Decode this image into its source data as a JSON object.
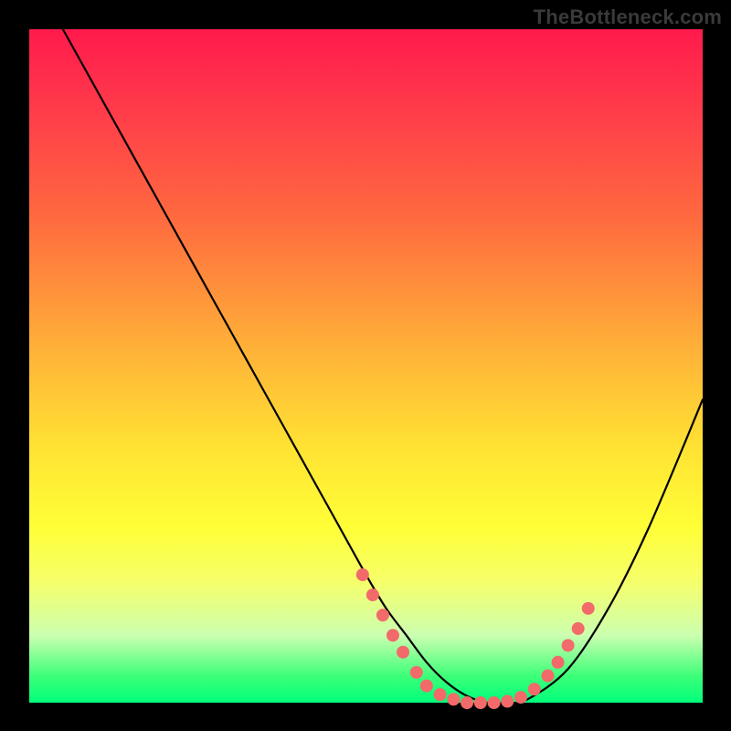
{
  "watermark": "TheBottleneck.com",
  "chart_data": {
    "type": "line",
    "title": "",
    "xlabel": "",
    "ylabel": "",
    "xlim": [
      0,
      100
    ],
    "ylim": [
      0,
      100
    ],
    "grid": false,
    "series": [
      {
        "name": "curve",
        "x": [
          5,
          10,
          15,
          20,
          25,
          30,
          35,
          40,
          45,
          50,
          53,
          56,
          59,
          62,
          65,
          68,
          71,
          74,
          80,
          86,
          92,
          100
        ],
        "values": [
          100,
          91,
          82,
          73,
          64,
          55,
          46,
          37,
          28,
          19,
          14,
          10,
          6,
          3,
          1,
          0,
          0,
          0.5,
          5,
          14,
          26,
          45
        ]
      }
    ],
    "highlight_points": {
      "color": "#f26a6a",
      "radius": 7,
      "points": [
        {
          "x": 49.5,
          "y": 19
        },
        {
          "x": 51,
          "y": 16
        },
        {
          "x": 52.5,
          "y": 13
        },
        {
          "x": 54,
          "y": 10
        },
        {
          "x": 55.5,
          "y": 7.5
        },
        {
          "x": 57.5,
          "y": 4.5
        },
        {
          "x": 59,
          "y": 2.5
        },
        {
          "x": 61,
          "y": 1.2
        },
        {
          "x": 63,
          "y": 0.5
        },
        {
          "x": 65,
          "y": 0
        },
        {
          "x": 67,
          "y": 0
        },
        {
          "x": 69,
          "y": 0
        },
        {
          "x": 71,
          "y": 0.2
        },
        {
          "x": 73,
          "y": 0.8
        },
        {
          "x": 75,
          "y": 2
        },
        {
          "x": 77,
          "y": 4
        },
        {
          "x": 78.5,
          "y": 6
        },
        {
          "x": 80,
          "y": 8.5
        },
        {
          "x": 81.5,
          "y": 11
        },
        {
          "x": 83,
          "y": 14
        }
      ]
    }
  }
}
